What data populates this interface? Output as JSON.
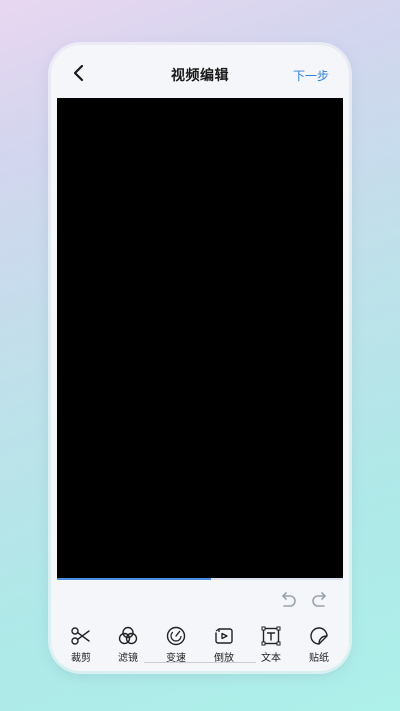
{
  "nav": {
    "title": "视频编辑",
    "next_label": "下一步",
    "back_icon": "chevron-left-icon"
  },
  "video": {
    "background": "#000000",
    "progress": 0.54
  },
  "history": {
    "undo_icon": "undo-icon",
    "redo_icon": "redo-icon"
  },
  "toolbar": {
    "items": [
      {
        "label": "裁剪",
        "icon": "scissors-icon"
      },
      {
        "label": "滤镜",
        "icon": "filter-icon"
      },
      {
        "label": "变速",
        "icon": "speed-gauge-icon"
      },
      {
        "label": "倒放",
        "icon": "reverse-play-icon"
      },
      {
        "label": "文本",
        "icon": "text-box-icon"
      },
      {
        "label": "贴纸",
        "icon": "sticker-icon"
      }
    ]
  },
  "colors": {
    "accent": "#2f7fd8",
    "progress": "#4a8fe0"
  }
}
